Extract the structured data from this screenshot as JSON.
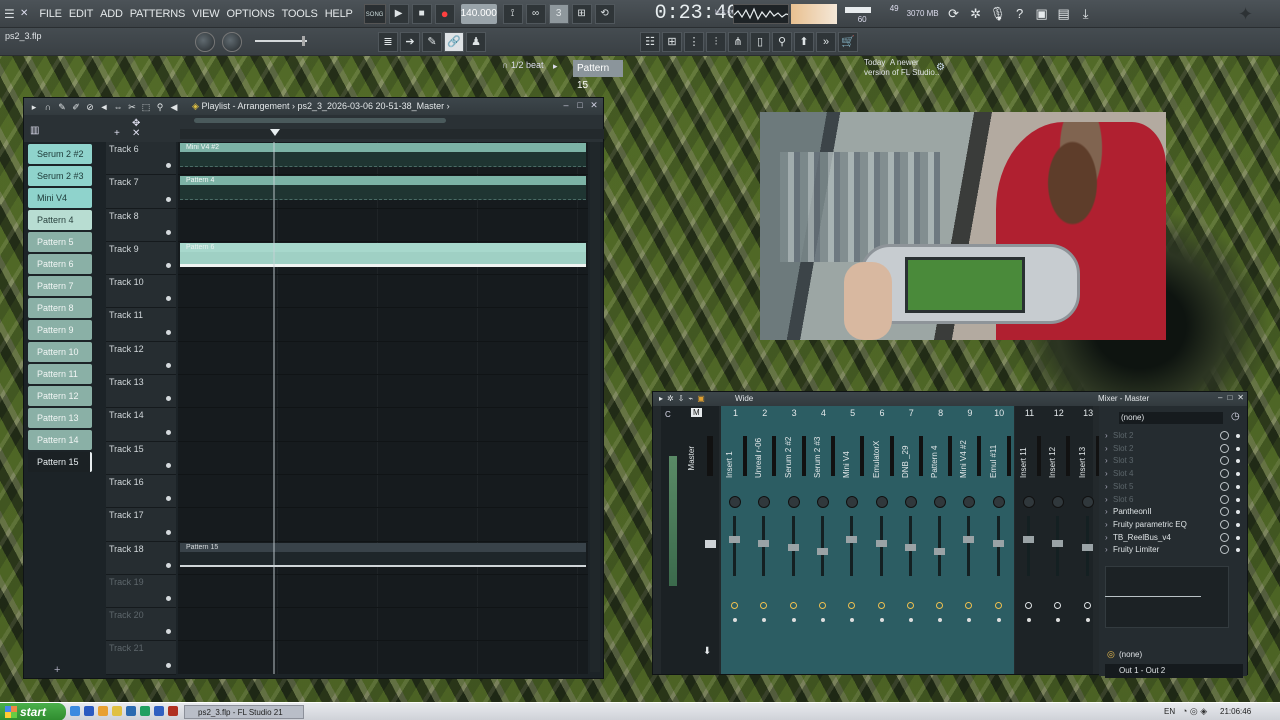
{
  "app": {
    "menu": [
      "FILE",
      "EDIT",
      "ADD",
      "PATTERNS",
      "VIEW",
      "OPTIONS",
      "TOOLS",
      "HELP"
    ],
    "song_mode": "SONG",
    "tempo": "140.000",
    "time": "0:23:40",
    "time_units": "M:S:CS",
    "cpu_value": "49",
    "memory": "3070 MB",
    "voices": "60",
    "file_name": "ps2_3.flp",
    "snap": "1/2 beat",
    "pattern_selector": "Pattern 15",
    "news_line1": "Today",
    "news_line1b": "A newer",
    "news_line2": "version of FL Studio.."
  },
  "playlist": {
    "title": "Playlist - Arrangement",
    "path": "ps2_3_2026-03-06 20-51-38_Master",
    "picker": [
      {
        "label": "Serum 2 #2",
        "style": "synth"
      },
      {
        "label": "Serum 2 #3",
        "style": "synth"
      },
      {
        "label": "Mini V4",
        "style": "synth"
      },
      {
        "label": "Pattern 4",
        "style": "pattern-light"
      },
      {
        "label": "Pattern 5",
        "style": "pattern"
      },
      {
        "label": "Pattern 6",
        "style": "pattern"
      },
      {
        "label": "Pattern 7",
        "style": "pattern"
      },
      {
        "label": "Pattern 8",
        "style": "pattern"
      },
      {
        "label": "Pattern 9",
        "style": "pattern"
      },
      {
        "label": "Pattern 10",
        "style": "pattern"
      },
      {
        "label": "Pattern 11",
        "style": "pattern"
      },
      {
        "label": "Pattern 12",
        "style": "pattern"
      },
      {
        "label": "Pattern 13",
        "style": "pattern"
      },
      {
        "label": "Pattern 14",
        "style": "pattern"
      },
      {
        "label": "Pattern 15",
        "style": "selected"
      }
    ],
    "tracks": [
      {
        "name": "Track 6",
        "clip": "Mini V4 #2",
        "clip_style": "teal"
      },
      {
        "name": "Track 7",
        "clip": "Pattern 4",
        "clip_style": "teal"
      },
      {
        "name": "Track 8",
        "clip": "",
        "clip_style": ""
      },
      {
        "name": "Track 9",
        "clip": "Pattern 6",
        "clip_style": "light"
      },
      {
        "name": "Track 10",
        "clip": "",
        "clip_style": ""
      },
      {
        "name": "Track 11",
        "clip": "",
        "clip_style": ""
      },
      {
        "name": "Track 12",
        "clip": "",
        "clip_style": ""
      },
      {
        "name": "Track 13",
        "clip": "",
        "clip_style": ""
      },
      {
        "name": "Track 14",
        "clip": "",
        "clip_style": ""
      },
      {
        "name": "Track 15",
        "clip": "",
        "clip_style": ""
      },
      {
        "name": "Track 16",
        "clip": "",
        "clip_style": ""
      },
      {
        "name": "Track 17",
        "clip": "",
        "clip_style": ""
      },
      {
        "name": "Track 18",
        "clip": "Pattern 15",
        "clip_style": "grey"
      },
      {
        "name": "Track 19",
        "clip": "",
        "clip_style": "",
        "dim": true
      },
      {
        "name": "Track 20",
        "clip": "",
        "clip_style": "",
        "dim": true
      },
      {
        "name": "Track 21",
        "clip": "",
        "clip_style": "",
        "dim": true
      }
    ]
  },
  "mixer": {
    "title": "Mixer - Master",
    "preset": "Wide",
    "master_label": "Master",
    "channels": [
      {
        "num": "1",
        "name": "Insert 1"
      },
      {
        "num": "2",
        "name": "Unreal r-06"
      },
      {
        "num": "3",
        "name": "Serum 2 #2"
      },
      {
        "num": "4",
        "name": "Serum 2 #3"
      },
      {
        "num": "5",
        "name": "Mini V4"
      },
      {
        "num": "6",
        "name": "EmulatorX"
      },
      {
        "num": "7",
        "name": "DNB _29"
      },
      {
        "num": "8",
        "name": "Pattern 4"
      },
      {
        "num": "9",
        "name": "Mini V4 #2"
      },
      {
        "num": "10",
        "name": "Emul #11"
      }
    ],
    "extra_channels": [
      {
        "num": "11",
        "name": "Insert 11"
      },
      {
        "num": "12",
        "name": "Insert 12"
      },
      {
        "num": "13",
        "name": "Insert 13"
      }
    ],
    "input": "(none)",
    "slots": [
      {
        "label": "Slot 2",
        "active": false
      },
      {
        "label": "Slot 2",
        "active": false
      },
      {
        "label": "Slot 3",
        "active": false
      },
      {
        "label": "Slot 4",
        "active": false
      },
      {
        "label": "Slot 5",
        "active": false
      },
      {
        "label": "Slot 6",
        "active": false
      },
      {
        "label": "PantheonII",
        "active": true
      },
      {
        "label": "Fruity parametric EQ",
        "active": true
      },
      {
        "label": "TB_ReelBus_v4",
        "active": true
      },
      {
        "label": "Fruity Limiter",
        "active": true
      }
    ],
    "output_select": "(none)",
    "output": "Out 1 - Out 2"
  },
  "taskbar": {
    "start": "start",
    "task": "ps2_3.flp - FL Studio 21",
    "language": "EN",
    "clock": "21:06:46"
  },
  "colors": {
    "accent_teal": "#7fb8b0",
    "clip_teal": "#7cb3a6",
    "insert_bg": "#2c5d63",
    "record": "#ff4040"
  }
}
